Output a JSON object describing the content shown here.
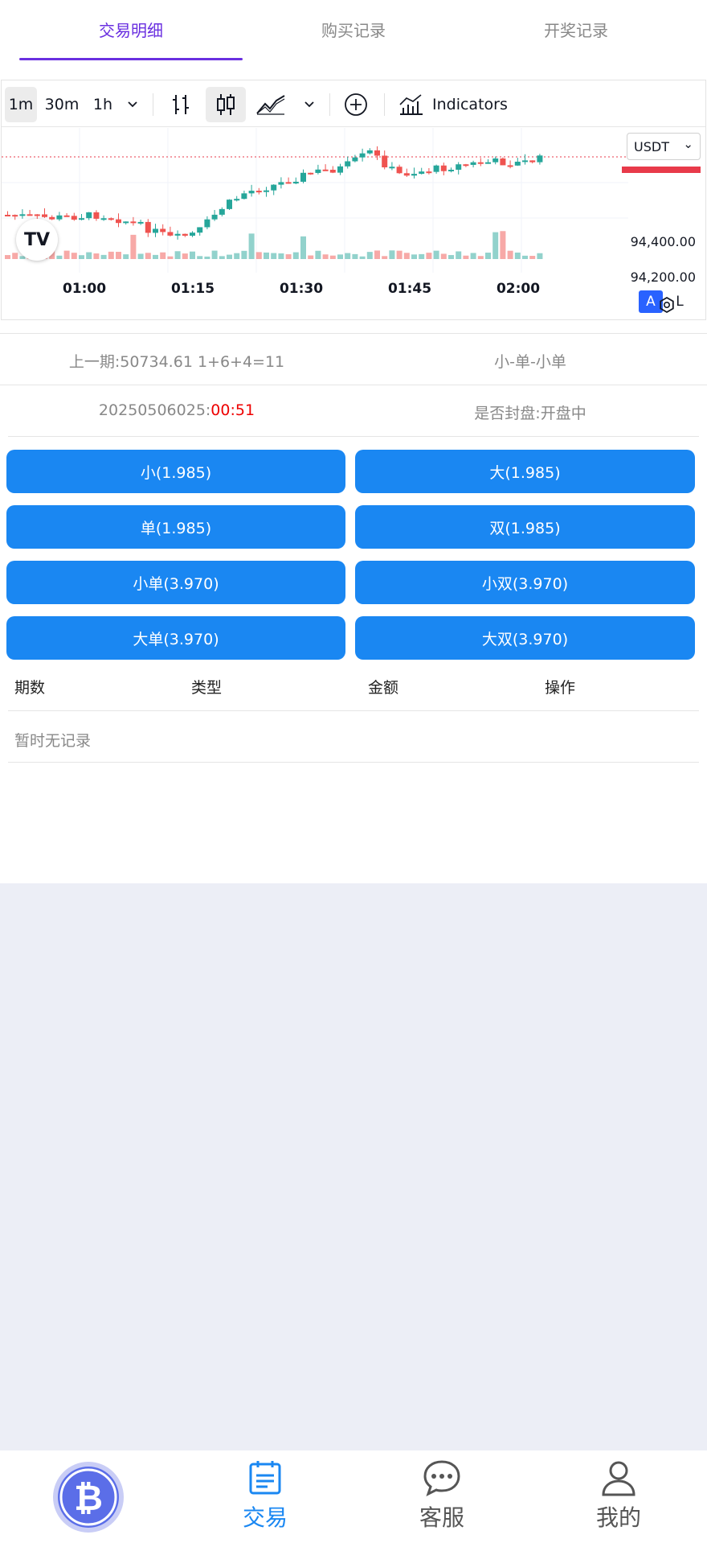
{
  "tabs": [
    {
      "label": "交易明细",
      "active": true
    },
    {
      "label": "购买记录",
      "active": false
    },
    {
      "label": "开奖记录",
      "active": false
    }
  ],
  "chart_toolbar": {
    "intervals": [
      "1m",
      "30m",
      "1h"
    ],
    "selected_interval": "1m",
    "indicators_label": "Indicators"
  },
  "chart_data": {
    "type": "candlestick",
    "currency": "USDT",
    "price_labels": [
      "94,400.00",
      "94,200.00"
    ],
    "time_labels": [
      "01:00",
      "01:15",
      "01:30",
      "01:45",
      "02:00"
    ],
    "scale_buttons": [
      "A",
      "L"
    ],
    "logo_text": "TV",
    "up_color": "#26a69a",
    "down_color": "#ef5350"
  },
  "draw": {
    "last_issue": "上一期:50734.61 1+6+4=11",
    "last_result": "小-单-小单",
    "current_issue": "20250506025:",
    "countdown": "00:51",
    "seal_status": "是否封盘:开盘中"
  },
  "bets": [
    {
      "label": "小(1.985)"
    },
    {
      "label": "大(1.985)"
    },
    {
      "label": "单(1.985)"
    },
    {
      "label": "双(1.985)"
    },
    {
      "label": "小单(3.970)"
    },
    {
      "label": "小双(3.970)"
    },
    {
      "label": "大单(3.970)"
    },
    {
      "label": "大双(3.970)"
    }
  ],
  "table": {
    "headers": [
      "期数",
      "类型",
      "金额",
      "操作"
    ],
    "empty_text": "暂时无记录"
  },
  "bottom_nav": [
    {
      "label": "",
      "icon": "bitcoin-icon"
    },
    {
      "label": "交易",
      "icon": "calendar-icon",
      "active": true
    },
    {
      "label": "客服",
      "icon": "chat-bubble-icon"
    },
    {
      "label": "我的",
      "icon": "user-icon"
    }
  ],
  "colors": {
    "accent": "#6a2fe0",
    "button_blue": "#1a87f2",
    "countdown_red": "#e00000",
    "page_bg": "#eceef6"
  }
}
